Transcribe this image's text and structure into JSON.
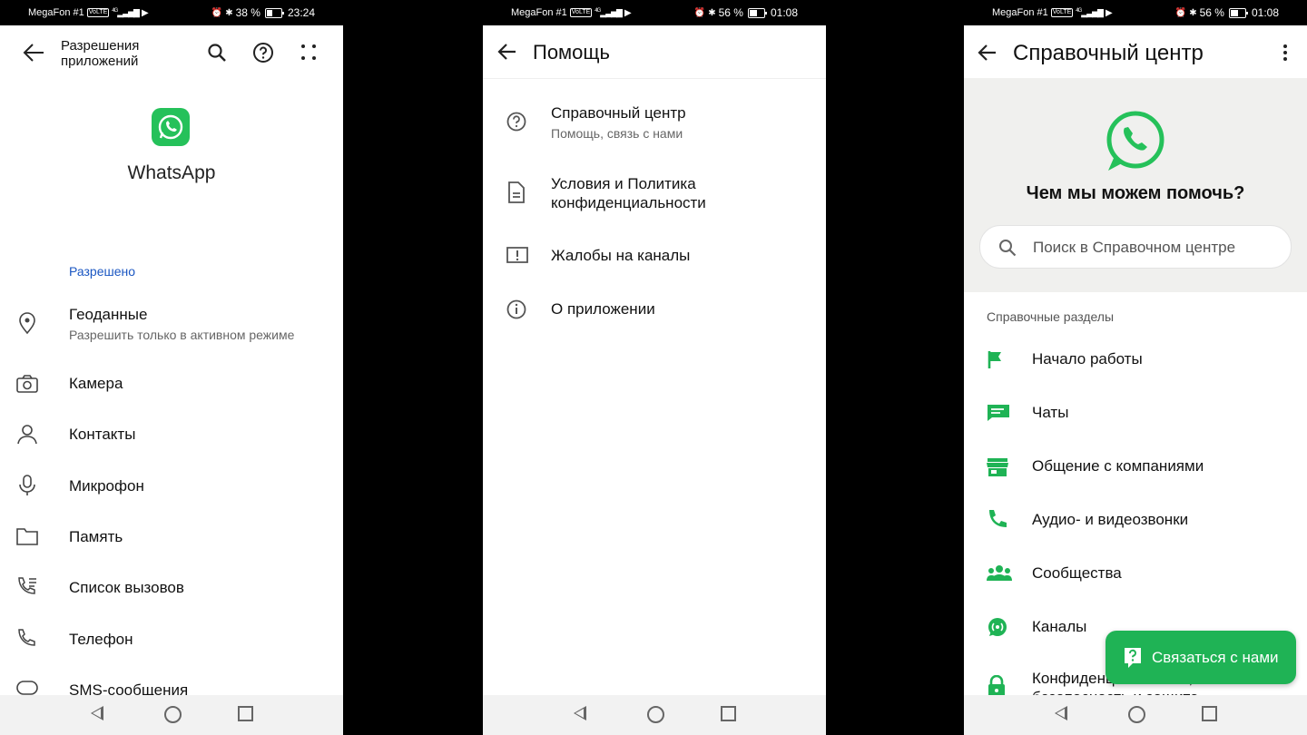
{
  "status_bars": [
    {
      "carrier": "MegaFon #1",
      "volte": "VoLTE",
      "net": "4G",
      "battery": "38 %",
      "time": "23:24",
      "battery_level": 0.38
    },
    {
      "carrier": "MegaFon #1",
      "volte": "VoLTE",
      "net": "4G",
      "battery": "56 %",
      "time": "01:08",
      "battery_level": 0.56
    },
    {
      "carrier": "MegaFon #1",
      "volte": "VoLTE",
      "net": "4G",
      "battery": "56 %",
      "time": "01:08",
      "battery_level": 0.56
    }
  ],
  "screen1": {
    "title_line1": "Разрешения",
    "title_line2": "приложений",
    "app_name": "WhatsApp",
    "section": "Разрешено",
    "permissions": [
      {
        "title": "Геоданные",
        "subtitle": "Разрешить только в активном режиме",
        "icon": "location-pin-icon"
      },
      {
        "title": "Камера",
        "icon": "camera-icon"
      },
      {
        "title": "Контакты",
        "icon": "person-icon"
      },
      {
        "title": "Микрофон",
        "icon": "microphone-icon"
      },
      {
        "title": "Память",
        "icon": "folder-icon"
      },
      {
        "title": "Список вызовов",
        "icon": "call-log-icon"
      },
      {
        "title": "Телефон",
        "icon": "phone-icon"
      },
      {
        "title": "SMS-сообщения",
        "icon": "message-icon"
      }
    ]
  },
  "screen2": {
    "title": "Помощь",
    "items": [
      {
        "title": "Справочный центр",
        "subtitle": "Помощь, связь с нами",
        "icon": "help-circle-icon"
      },
      {
        "title_line1": "Условия и Политика",
        "title_line2": "конфиденциальности",
        "icon": "document-icon"
      },
      {
        "title": "Жалобы на каналы",
        "icon": "report-icon"
      },
      {
        "title": "О приложении",
        "icon": "info-icon"
      }
    ]
  },
  "screen3": {
    "title": "Справочный центр",
    "question": "Чем мы можем помочь?",
    "search_placeholder": "Поиск в Справочном центре",
    "section": "Справочные разделы",
    "topics": [
      {
        "title": "Начало работы",
        "icon": "flag-icon"
      },
      {
        "title": "Чаты",
        "icon": "chat-icon"
      },
      {
        "title": "Общение с компаниями",
        "icon": "store-icon"
      },
      {
        "title": "Аудио- и видеозвонки",
        "icon": "call-icon"
      },
      {
        "title": "Сообщества",
        "icon": "group-icon"
      },
      {
        "title": "Каналы",
        "icon": "channel-icon"
      },
      {
        "title_line1": "Конфиденциальность,",
        "title_line2": "безопасность и защита",
        "icon": "lock-icon"
      }
    ],
    "fab_label": "Связаться с нами",
    "accent": "#1fb355"
  }
}
